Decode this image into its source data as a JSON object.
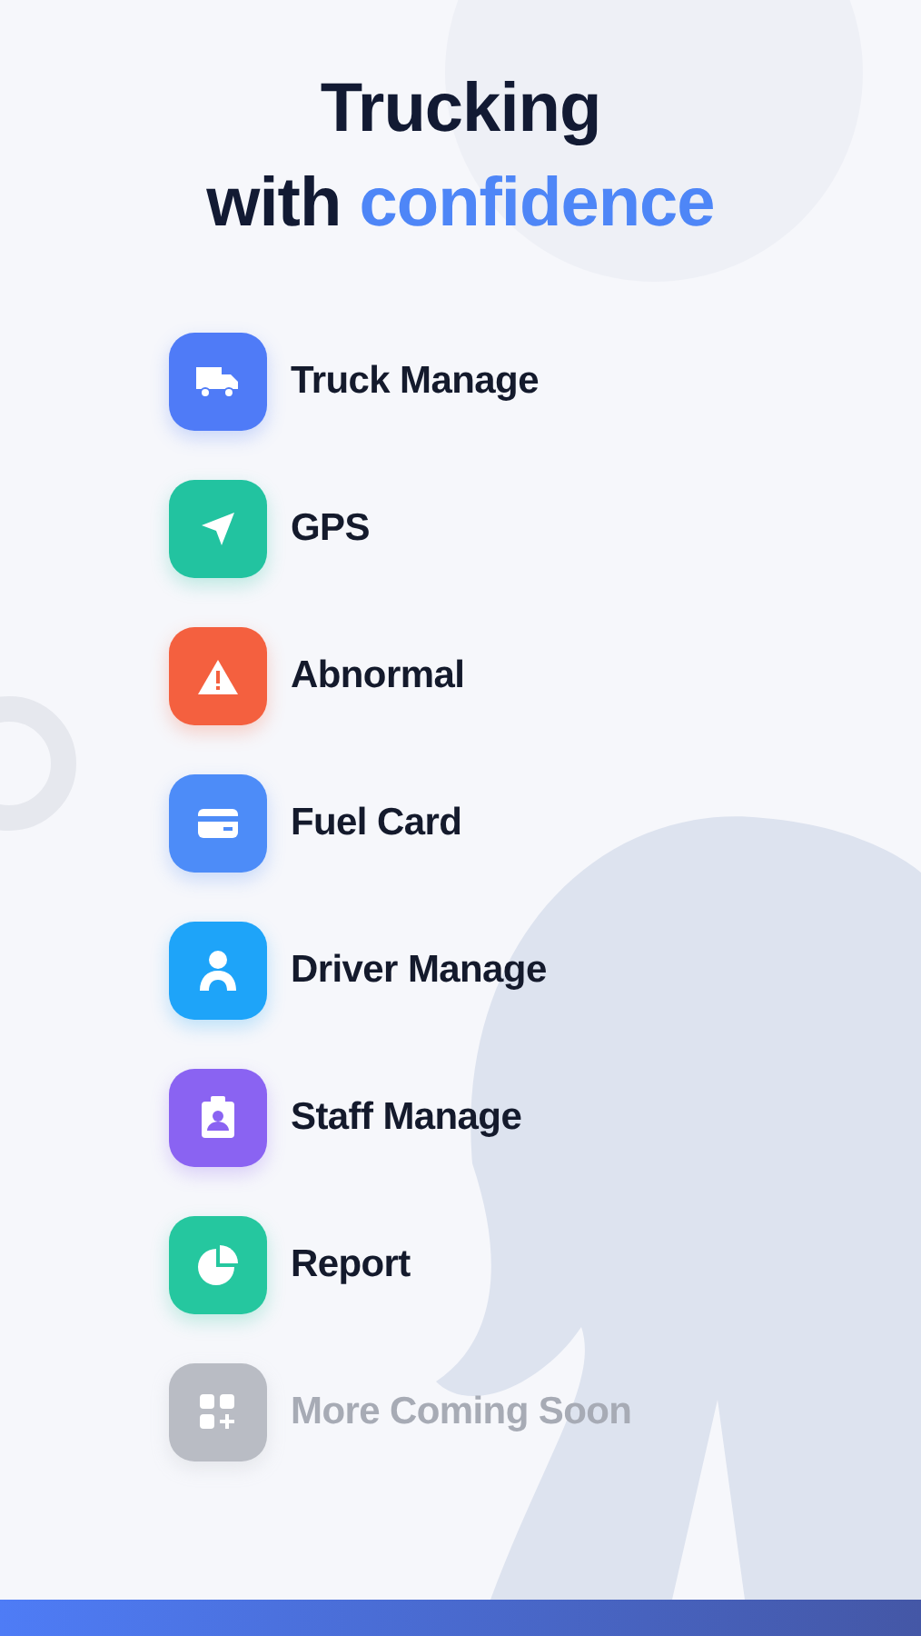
{
  "headline": {
    "line_1": "Trucking",
    "line_2_prefix": "with",
    "line_2_accent": "confidence"
  },
  "features": [
    {
      "kind": "truck",
      "label": "Truck Manage",
      "color": "#4f7bf7",
      "disabled": false
    },
    {
      "kind": "gps",
      "label": "GPS",
      "color": "#22c3a0",
      "disabled": false
    },
    {
      "kind": "warning",
      "label": "Abnormal",
      "color": "#f4603f",
      "disabled": false
    },
    {
      "kind": "card",
      "label": "Fuel Card",
      "color": "#4d8cf8",
      "disabled": false
    },
    {
      "kind": "driver",
      "label": "Driver Manage",
      "color": "#1ea4f9",
      "disabled": false
    },
    {
      "kind": "badge",
      "label": "Staff Manage",
      "color": "#8a63f2",
      "disabled": false
    },
    {
      "kind": "chart",
      "label": "Report",
      "color": "#25c79f",
      "disabled": false
    },
    {
      "kind": "more",
      "label": "More Coming Soon",
      "color": "#b9bcc4",
      "disabled": true
    }
  ]
}
